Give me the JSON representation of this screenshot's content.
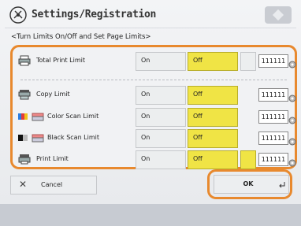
{
  "header": {
    "title": "Settings/Registration"
  },
  "subtitle": "<Turn Limits On/Off and Set Page Limits>",
  "rows": [
    {
      "label": "Total Print Limit",
      "on": "On",
      "off": "Off",
      "value": "111111",
      "selected": "Off"
    },
    {
      "label": "Copy Limit",
      "on": "On",
      "off": "Off",
      "value": "111111",
      "selected": "Off"
    },
    {
      "label": "Color Scan Limit",
      "on": "On",
      "off": "Off",
      "value": "111111",
      "selected": "Off"
    },
    {
      "label": "Black Scan Limit",
      "on": "On",
      "off": "Off",
      "value": "111111",
      "selected": "Off"
    },
    {
      "label": "Print Limit",
      "on": "On",
      "off": "Off",
      "value": "111111",
      "selected": "Off"
    }
  ],
  "footer": {
    "cancel": "Cancel",
    "ok": "OK"
  },
  "colors": {
    "accent": "#e8892e",
    "selected": "#f0e445"
  }
}
